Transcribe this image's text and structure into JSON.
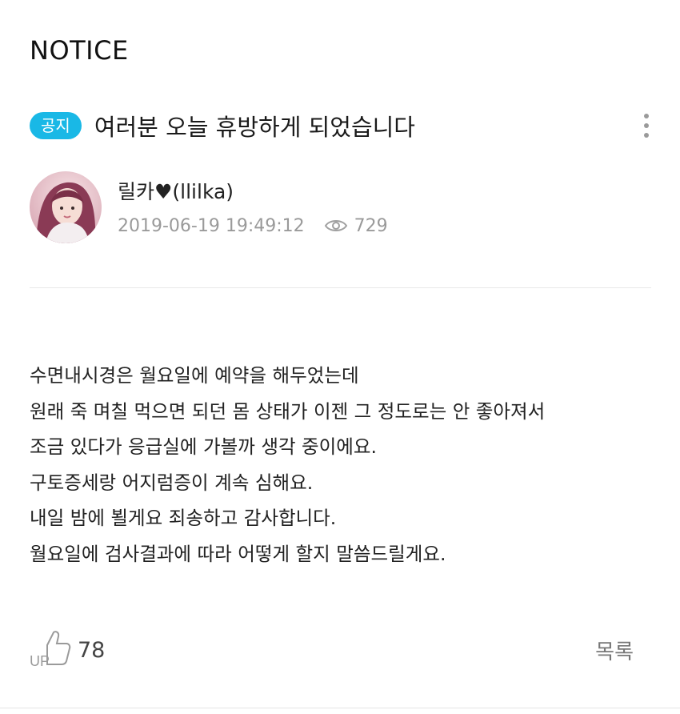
{
  "board": {
    "title": "NOTICE"
  },
  "post": {
    "badge": "공지",
    "title": "여러분 오늘 휴방하게 되었습니다",
    "author": "릴카♥(llilka)",
    "datetime": "2019-06-19 19:49:12",
    "views": "729",
    "body_lines": [
      "수면내시경은 월요일에 예약을 해두었는데",
      "원래 죽 며칠 먹으면 되던 몸 상태가 이젠 그 정도로는 안 좋아져서",
      "조금 있다가 응급실에 가볼까 생각 중이에요.",
      "구토증세랑 어지럼증이 계속 심해요.",
      "내일 밤에 뵐게요 죄송하고 감사합니다.",
      "월요일에 검사결과에 따라 어떻게 할지 말씀드릴게요."
    ]
  },
  "footer": {
    "like_count": "78",
    "like_icon_text": "UP",
    "list_label": "목록"
  },
  "icons": {
    "more": "more-vertical-icon",
    "views": "eye-icon",
    "like": "thumbs-up-icon"
  },
  "colors": {
    "badge": "#19b8e6",
    "meta": "#9a9a9a"
  }
}
